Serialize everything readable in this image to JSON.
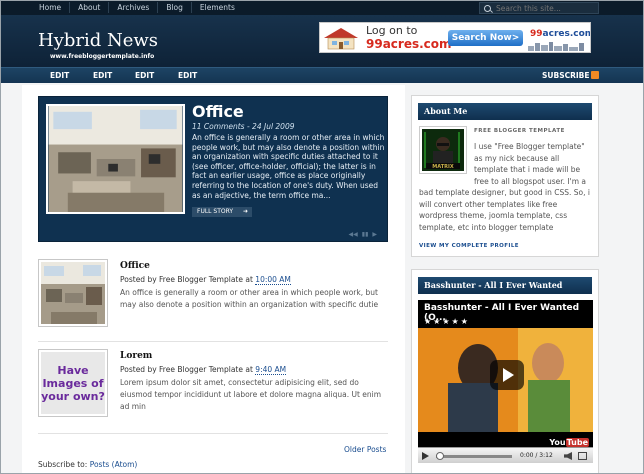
{
  "topnav": {
    "links": [
      "Home",
      "About",
      "Archives",
      "Blog",
      "Elements"
    ],
    "search_placeholder": "Search this site..."
  },
  "header": {
    "title": "Hybrid News",
    "subtitle": "www.freebloggertemplate.info"
  },
  "ad": {
    "logon": "Log on to",
    "brand": "99acres.com",
    "button": "Search Now>",
    "brand2_main": "99",
    "brand2_rest": "acres.com"
  },
  "editbar": {
    "items": [
      "EDIT",
      "EDIT",
      "EDIT",
      "EDIT"
    ],
    "subscribe": "SUBSCRIBE"
  },
  "feature": {
    "title": "Office",
    "meta": "11 Comments - 24 Jul 2009",
    "desc": "An office is generally a room or other area in which people work, but may also denote a position within an organization with specific duties attached to it (see officer, office-holder, official); the latter is in fact an earlier usage, office as place originally referring to the location of one's duty. When used as an adjective, the term office ma...",
    "button": "FULL STORY",
    "pager": [
      "◀◀",
      "▮▮",
      "▶"
    ]
  },
  "posts": [
    {
      "title": "Office",
      "meta_prefix": "Posted by Free Blogger Template at ",
      "time": "10:00 AM",
      "body": "An office is generally a room or other area in which people work, but may also denote a position within an organization with specific dutie"
    },
    {
      "title": "Lorem",
      "meta_prefix": "Posted by Free Blogger Template at ",
      "time": "9:40 AM",
      "body": "Lorem ipsum dolor sit amet, consectetur adipisicing elit, sed do eiusmod tempor incididunt ut labore et dolore magna aliqua. Ut enim ad min",
      "image_text": "Have Images of your own?"
    }
  ],
  "older_posts": "Older Posts",
  "subscribe": {
    "label": "Subscribe to: ",
    "link": "Posts (Atom)"
  },
  "about": {
    "title": "About Me",
    "label": "FREE BLOGGER TEMPLATE",
    "avatar_caption": "MATRIX",
    "text1": "I use \"Free Blogger template\" as my nick because all template that i made will be free to all blogspot user. I'm a",
    "text2": "bad template designer, but good in CSS. So, i will convert other templates like free wordpress theme, joomla template, css template, etc into blogger template",
    "view_profile": "VIEW MY COMPLETE PROFILE"
  },
  "video": {
    "title": "Basshunter - All I Ever Wanted",
    "player_title": "Basshunter - All I Ever Wanted (O...",
    "stars": "★★★★★",
    "time": "0:00 / 3:12",
    "youtube_a": "You",
    "youtube_b": "Tube"
  }
}
